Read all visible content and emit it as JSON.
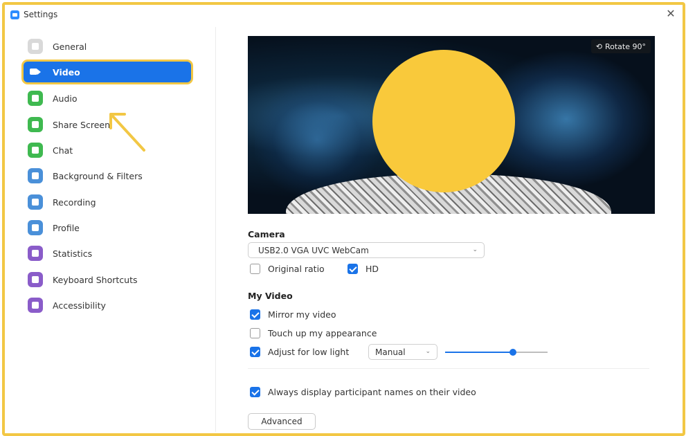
{
  "window": {
    "title": "Settings"
  },
  "sidebar": {
    "items": [
      {
        "label": "General",
        "color": "#d9d9d9"
      },
      {
        "label": "Video",
        "color": "#1a73e8",
        "active": true
      },
      {
        "label": "Audio",
        "color": "#3fb950"
      },
      {
        "label": "Share Screen",
        "color": "#3fb950"
      },
      {
        "label": "Chat",
        "color": "#3fb950"
      },
      {
        "label": "Background & Filters",
        "color": "#4a90d9"
      },
      {
        "label": "Recording",
        "color": "#4a90d9"
      },
      {
        "label": "Profile",
        "color": "#4a90d9"
      },
      {
        "label": "Statistics",
        "color": "#8a5cc9"
      },
      {
        "label": "Keyboard Shortcuts",
        "color": "#8a5cc9"
      },
      {
        "label": "Accessibility",
        "color": "#8a5cc9"
      }
    ]
  },
  "video": {
    "rotate_label": "Rotate 90°",
    "camera_heading": "Camera",
    "camera_value": "USB2.0 VGA UVC WebCam",
    "original_ratio_label": "Original ratio",
    "original_ratio_checked": false,
    "hd_label": "HD",
    "hd_checked": true,
    "my_video_heading": "My Video",
    "mirror_label": "Mirror my video",
    "mirror_checked": true,
    "touch_up_label": "Touch up my appearance",
    "touch_up_checked": false,
    "low_light_label": "Adjust for low light",
    "low_light_checked": true,
    "low_light_mode": "Manual",
    "low_light_level": 0.66,
    "names_label": "Always display participant names on their video",
    "names_checked": true,
    "advanced_label": "Advanced"
  },
  "colors": {
    "accent": "#1a73e8",
    "highlight": "#f2c744"
  }
}
